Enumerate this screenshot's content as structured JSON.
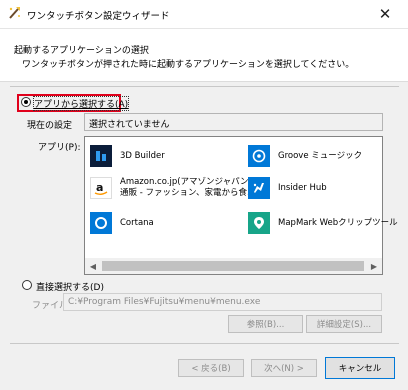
{
  "window": {
    "title": "ワンタッチボタン設定ウィザード",
    "close_glyph": "✕"
  },
  "header": {
    "title": "起動するアプリケーションの選択",
    "description": "ワンタッチボタンが押された時に起動するアプリケーションを選択してください。"
  },
  "app_option": {
    "label": "アプリから選択する(A)",
    "selected": true,
    "current_setting_label": "現在の設定",
    "current_setting_value": "選択されていません",
    "apps_label": "アプリ(P):",
    "apps": [
      {
        "name_lines": [
          "3D Builder"
        ],
        "icon": "3d-builder-icon",
        "color": "#0b1d3a"
      },
      {
        "name_lines": [
          "Groove ミュージック"
        ],
        "icon": "groove-music-icon",
        "color": "#0078d7"
      },
      {
        "name_lines": [
          "Amazon.co.jp(アマゾンジャパン):",
          "通販 - ファッション、家電から食..."
        ],
        "icon": "amazon-icon",
        "color": "#ffffff"
      },
      {
        "name_lines": [
          "Insider Hub"
        ],
        "icon": "insider-hub-icon",
        "color": "#0078d7"
      },
      {
        "name_lines": [
          "Cortana"
        ],
        "icon": "cortana-icon",
        "color": "#0078d7"
      },
      {
        "name_lines": [
          "MapMark Webクリップツール"
        ],
        "icon": "mapmark-icon",
        "color": "#17a589"
      }
    ]
  },
  "direct_option": {
    "label": "直接選択する(D)",
    "selected": false,
    "file_label": "ファイル",
    "file_value": "C:¥Program Files¥Fujitsu¥menu¥menu.exe",
    "browse_button": "参照(B)...",
    "detail_button": "詳細設定(S)..."
  },
  "footer": {
    "back_button": "< 戻る(B)",
    "next_button": "次へ(N) >",
    "cancel_button": "キャンセル"
  },
  "colors": {
    "highlight_border": "#e0001b",
    "accent": "#0078d7"
  }
}
